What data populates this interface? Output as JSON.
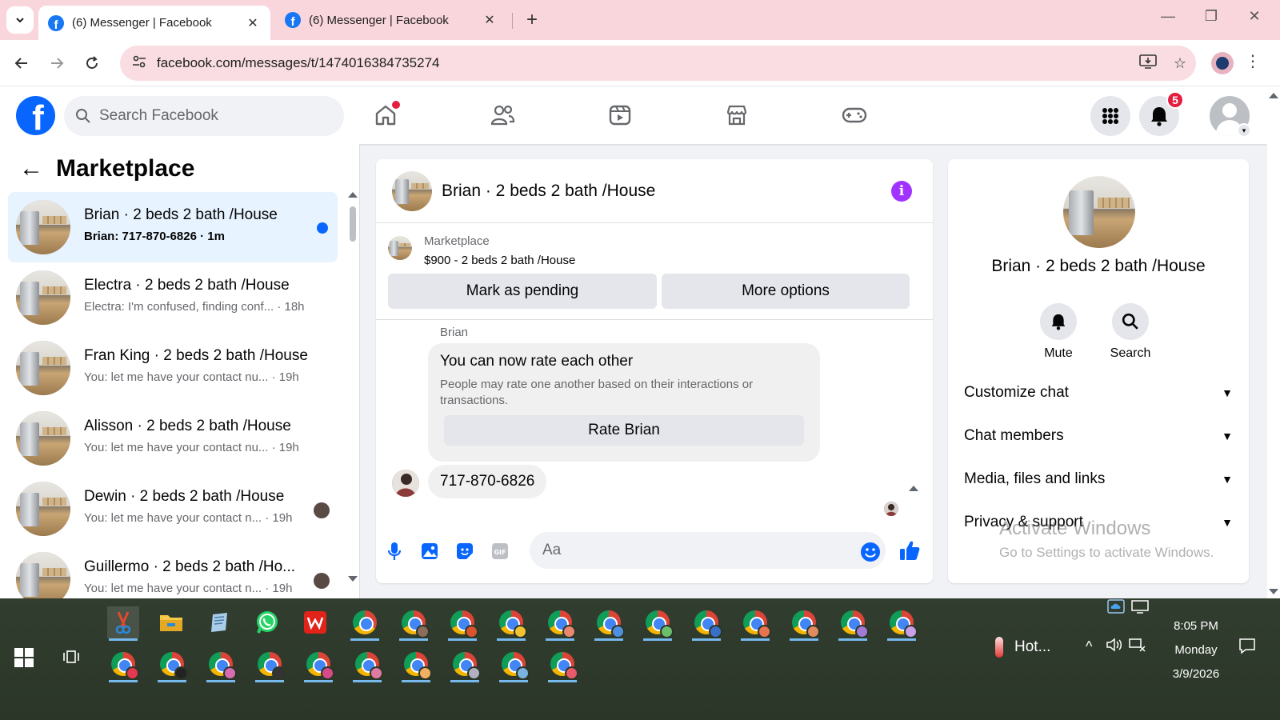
{
  "browser": {
    "tabs": [
      {
        "title": "(6) Messenger | Facebook",
        "active": true
      },
      {
        "title": "(6) Messenger | Facebook",
        "active": false
      }
    ],
    "url": "facebook.com/messages/t/1474016384735274"
  },
  "fbnav": {
    "logo": "f",
    "search_placeholder": "Search Facebook",
    "notification_count": "5",
    "icons": [
      "home-icon",
      "friends-icon",
      "video-icon",
      "marketplace-icon",
      "gaming-icon",
      "menu-grid-icon",
      "bell-icon",
      "profile-avatar"
    ]
  },
  "left_panel": {
    "back_icon": "←",
    "title": "Marketplace",
    "conversations": [
      {
        "name": "Brian · 2 beds 2 bath /House",
        "preview": "Brian: 717-870-6826 · 1m",
        "selected": true,
        "unread": true
      },
      {
        "name": "Electra · 2 beds 2 bath /House",
        "preview": "Electra: I'm confused, finding conf... · 18h",
        "selected": false
      },
      {
        "name": "Fran King · 2 beds 2 bath /House",
        "preview": "You: let me have your contact nu... · 19h",
        "selected": false
      },
      {
        "name": "Alisson · 2 beds 2 bath /House",
        "preview": "You: let me have your contact nu... · 19h",
        "selected": false
      },
      {
        "name": "Dewin · 2 beds 2 bath /House",
        "preview": "You: let me have your contact n... · 19h",
        "selected": false,
        "seen": true
      },
      {
        "name": "Guillermo · 2 beds 2 bath /Ho...",
        "preview": "You: let me have your contact n... · 19h",
        "selected": false,
        "seen": true
      }
    ]
  },
  "chat": {
    "title": "Brian · 2 beds 2 bath /House",
    "info_icon": "i",
    "listing": {
      "category": "Marketplace",
      "description": "$900 - 2 beds 2 bath /House",
      "pending_label": "Mark as pending",
      "more_label": "More options"
    },
    "sender_name": "Brian",
    "rate_card": {
      "title": "You can now rate each other",
      "body": "People may rate one another based on their interactions or transactions.",
      "button": "Rate Brian"
    },
    "message": "717-870-6826",
    "composer_placeholder": "Aa"
  },
  "right_panel": {
    "name": "Brian · 2 beds 2 bath /House",
    "actions": [
      {
        "label": "Mute",
        "icon": "bell-icon"
      },
      {
        "label": "Search",
        "icon": "search-icon"
      }
    ],
    "sections": [
      "Customize chat",
      "Chat members",
      "Media, files and links",
      "Privacy & support"
    ],
    "watermark_title": "Activate Windows",
    "watermark_sub": "Go to Settings to activate Windows."
  },
  "taskbar": {
    "weather": "Hot...",
    "time": "8:05 PM",
    "day": "Monday",
    "date": "3/9/2026"
  },
  "colors": {
    "facebook_blue": "#0866ff",
    "tabstrip": "#f9d6dc",
    "selected_convo": "#e7f3ff",
    "notification_red": "#e41e3f",
    "info_purple": "#a033ff"
  }
}
